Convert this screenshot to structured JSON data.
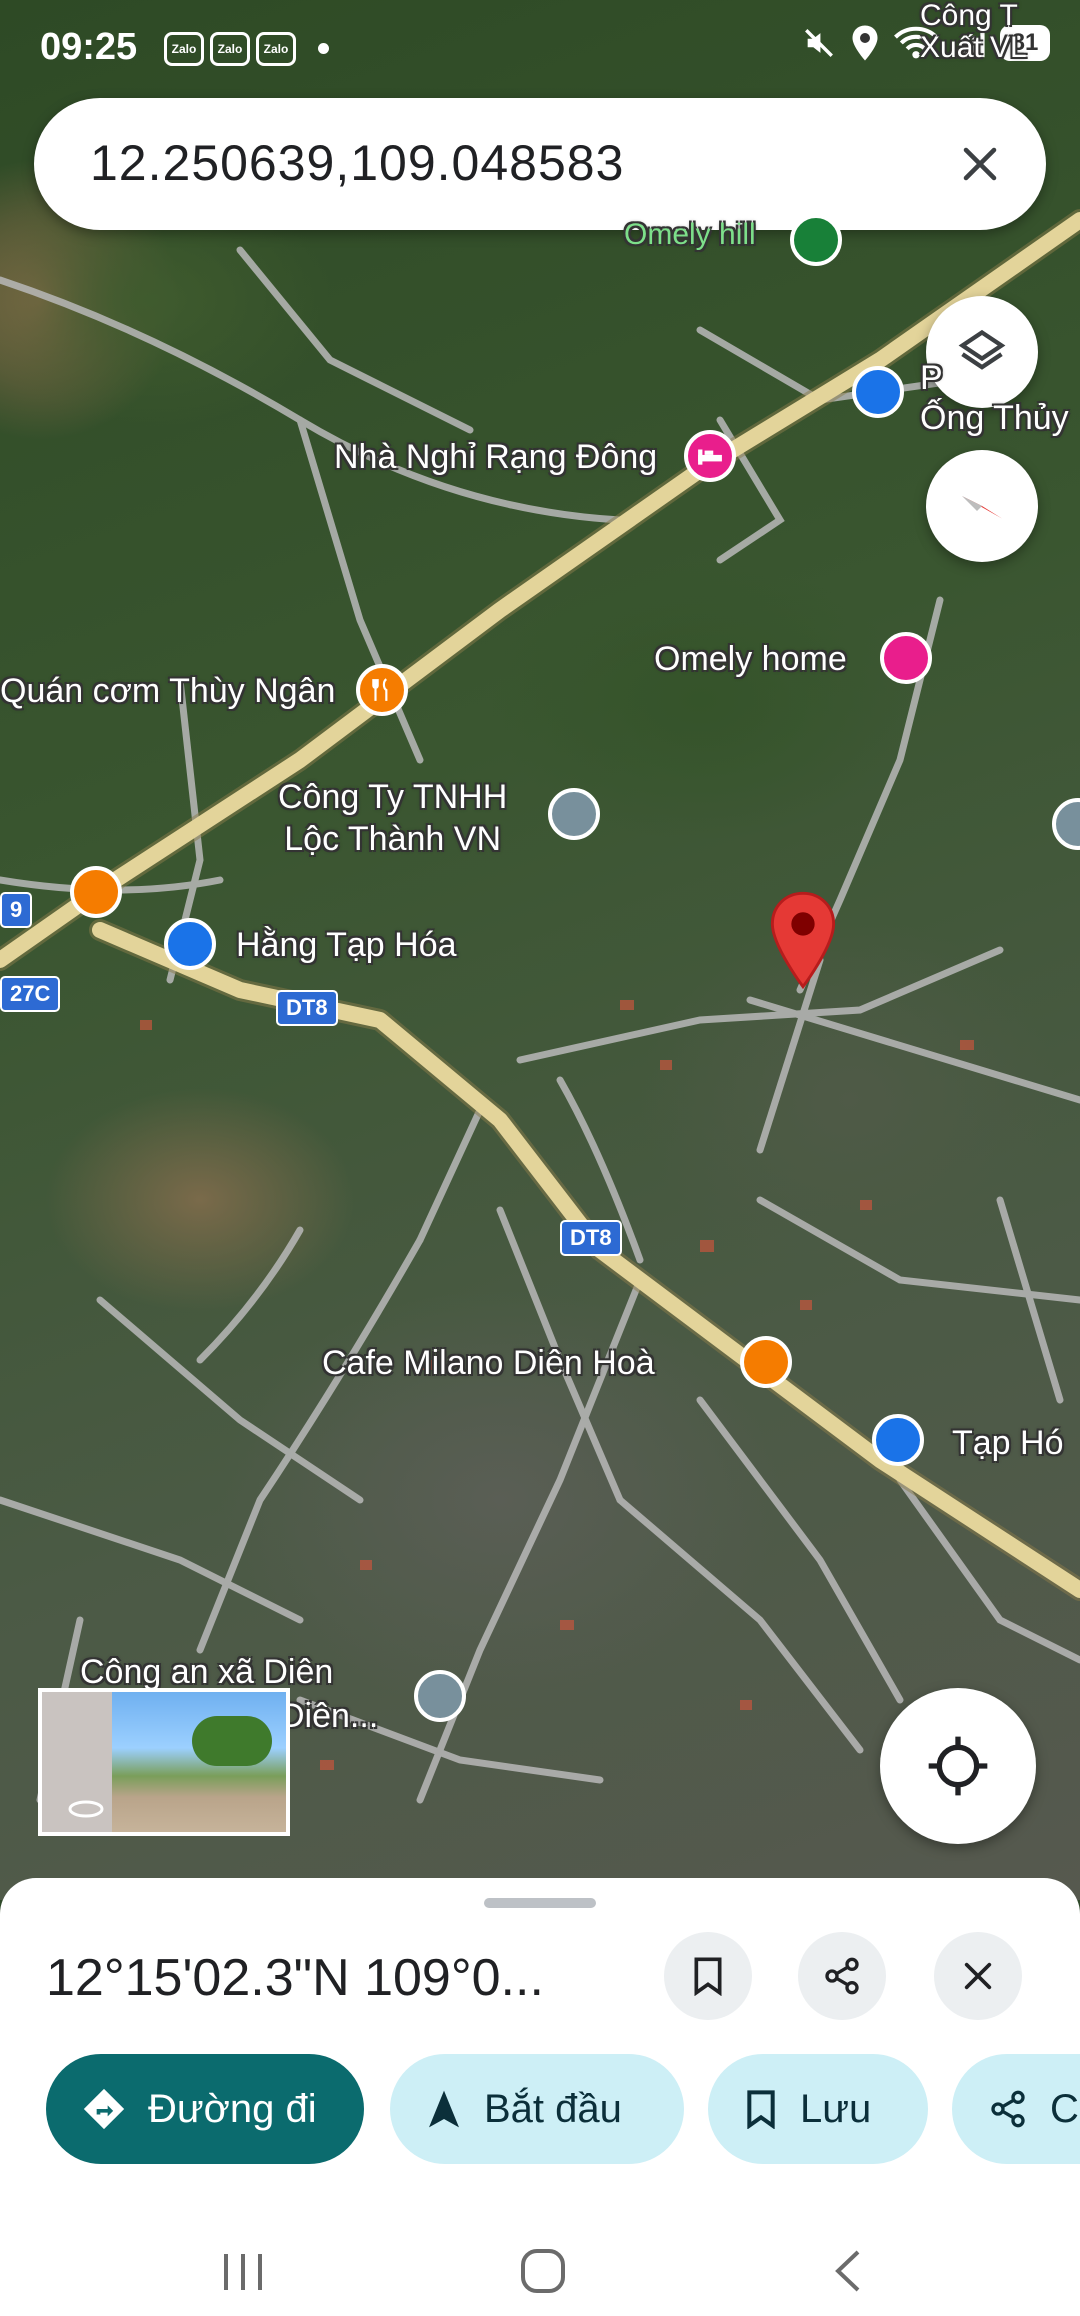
{
  "status_bar": {
    "time": "09:25",
    "notification_apps": [
      "Zalo",
      "Zalo",
      "Zalo"
    ],
    "battery": "81",
    "icons": [
      "mute-icon",
      "location-icon",
      "wifi-icon",
      "signal-icon",
      "battery-icon"
    ]
  },
  "search": {
    "value": "12.250639,109.048583"
  },
  "map": {
    "labels": {
      "omely_hill": "Omely hill",
      "nha_nghi": "Nhà Nghỉ Rạng Đông",
      "quan_com": "Quán cơm Thùy Ngân",
      "omely_home": "Omely home",
      "cong_ty_line1": "Công Ty TNHH",
      "cong_ty_line2": "Lộc Thành VN",
      "hang_tap_hoa": "Hằng Tạp Hóa",
      "cafe_milano": "Cafe Milano Diên Hoà",
      "tap_hoa_right": "Tạp Hó",
      "cong_an_line1": "Công an xã Diên",
      "cong_an_line2": "Diên...",
      "ong_thuy_line1": "P",
      "ong_thuy_line2": "Ống Thủy",
      "top_right_line1": "Công T",
      "top_right_line2": "Xuất VL"
    },
    "road_badges": {
      "dt8_a": "DT8",
      "dt8_b": "DT8",
      "r27c": "27C",
      "r9": "9"
    },
    "colors": {
      "main_road": "#e3d49a",
      "minor_road": "#b9b9b9",
      "pin": "#e53935",
      "poi_orange": "#f57c00",
      "poi_blue": "#1a73e8",
      "poi_pink": "#e91e8c",
      "poi_gray": "#78909c",
      "poi_green": "#188038"
    }
  },
  "sheet": {
    "coordinates": "12°15'02.3\"N 109°0...",
    "actions": {
      "directions": "Đường đi",
      "start": "Bắt đầu",
      "save": "Lưu",
      "share": "C"
    },
    "accent": "#0b6b6e"
  }
}
